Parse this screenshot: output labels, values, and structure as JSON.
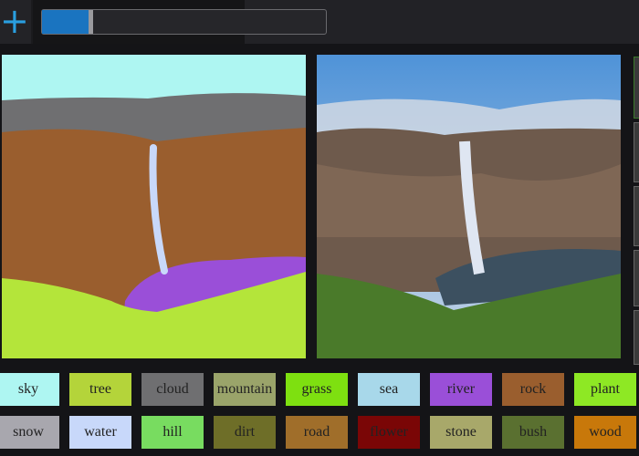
{
  "toolbar": {
    "add_icon": "plus-icon",
    "progress_percent": 17
  },
  "labels": [
    {
      "label": "sky",
      "color": "#aef6f2"
    },
    {
      "label": "tree",
      "color": "#b4d43a"
    },
    {
      "label": "cloud",
      "color": "#6f6f71"
    },
    {
      "label": "mountain",
      "color": "#9aa46a"
    },
    {
      "label": "grass",
      "color": "#7ee010"
    },
    {
      "label": "sea",
      "color": "#a8d8ea"
    },
    {
      "label": "river",
      "color": "#9a4fd8"
    },
    {
      "label": "rock",
      "color": "#9a5e2e"
    },
    {
      "label": "plant",
      "color": "#8ee824"
    },
    {
      "label": "snow",
      "color": "#a8a7ae"
    },
    {
      "label": "water",
      "color": "#c8d8fa"
    },
    {
      "label": "hill",
      "color": "#78dc60"
    },
    {
      "label": "dirt",
      "color": "#6e6e28"
    },
    {
      "label": "road",
      "color": "#a06e2a"
    },
    {
      "label": "flower",
      "color": "#7a0606"
    },
    {
      "label": "stone",
      "color": "#a8a86a"
    },
    {
      "label": "bush",
      "color": "#5a7030"
    },
    {
      "label": "wood",
      "color": "#c8780a"
    }
  ]
}
